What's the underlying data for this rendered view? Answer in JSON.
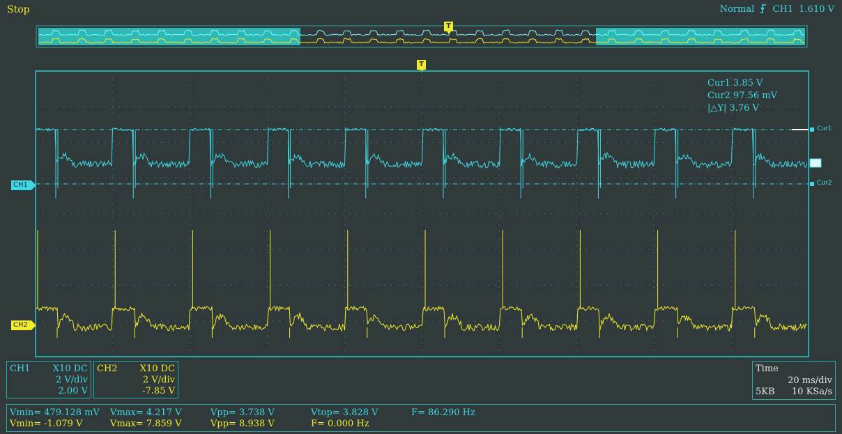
{
  "status": "Stop",
  "trigger": {
    "mode": "Normal",
    "edge_icon": "rising-edge-icon",
    "source": "CH1",
    "level": "1.610 V"
  },
  "trigger_marker": "T",
  "channel_tags": {
    "ch1": "CH1",
    "ch2": "CH2"
  },
  "cursor_tags": {
    "cur1": "Cur1",
    "cur2": "Cur2"
  },
  "cursor_readout": {
    "cur1": "Cur1  3.85 V",
    "cur2": "Cur2  97.56 mV",
    "delta": "|△Y|  3.76 V"
  },
  "ch1_box": {
    "name": "CH1",
    "probe": "X10  DC",
    "scale": "2 V/div",
    "offset": "2.00 V"
  },
  "ch2_box": {
    "name": "CH2",
    "probe": "X10  DC",
    "scale": "2 V/div",
    "offset": "-7.85 V"
  },
  "time_box": {
    "title": "Time",
    "scale": "20 ms/div",
    "memory": "5KB",
    "rate": "10 KSa/s"
  },
  "measurements": {
    "ch1": {
      "vmin": "Vmin= 479.128 mV",
      "vmax": "Vmax= 4.217 V",
      "vpp": "Vpp= 3.738 V",
      "vtop": "Vtop= 3.828 V",
      "freq": "F= 86.290 Hz"
    },
    "ch2": {
      "vmin": "Vmin= -1.079 V",
      "vmax": "Vmax= 7.859 V",
      "vpp": "Vpp= 8.938 V",
      "freq": "F= 0.000 Hz"
    }
  },
  "colors": {
    "ch1": "#3ed8e4",
    "ch2": "#f2ea2c",
    "background": "#313a3a",
    "grid": "#2aa7a7"
  }
}
